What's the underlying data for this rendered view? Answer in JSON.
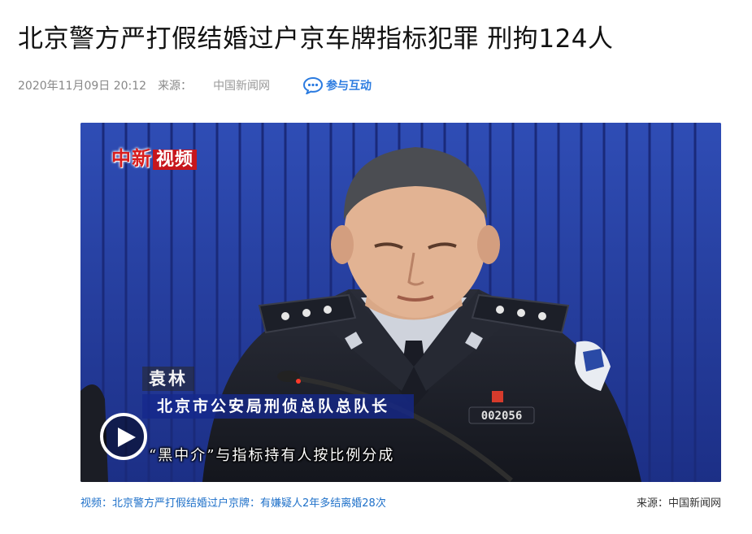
{
  "article": {
    "title": "北京警方严打假结婚过户京车牌指标犯罪 刑拘124人",
    "datetime": "2020年11月09日 20:12",
    "source_label": "来源：",
    "source_name": "中国新闻网",
    "interact_label": "参与互动"
  },
  "video": {
    "logo_text": "中新",
    "logo_badge": "视频",
    "person_name": "袁林",
    "person_title": "北京市公安局刑侦总队总队长",
    "subtitle": "“黑中介”与指标持有人按比例分成",
    "badge_number": "002056",
    "caption": "视频：北京警方严打假结婚过户京牌：有嫌疑人2年多结离婚28次",
    "caption_source": "来源：中国新闻网"
  },
  "colors": {
    "accent": "#2b7be0",
    "backdrop": "#253fa0",
    "logo_red": "#c7161d"
  },
  "icons": {
    "interact": "chat-bubble-icon",
    "play": "play-icon"
  }
}
